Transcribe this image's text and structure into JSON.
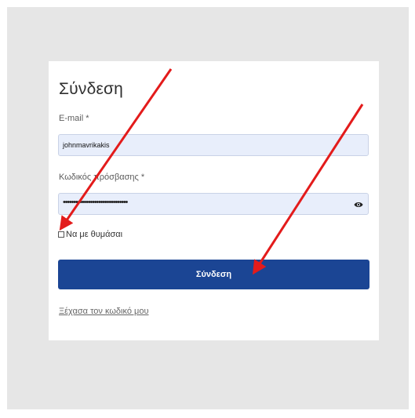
{
  "login": {
    "title": "Σύνδεση",
    "email_label": "E-mail *",
    "email_value": "johnmavrikakis",
    "password_label": "Κωδικός πρόσβασης *",
    "password_mask": "•••••••••••••••••••••••••••••••",
    "remember_label": "Να με θυμάσαι",
    "submit_label": "Σύνδεση",
    "forgot_link": "Ξέχασα τον κωδικό μου"
  },
  "annotations": {
    "arrow_color": "#e31b1b"
  },
  "icons": {
    "password_toggle": "eye-icon",
    "remember_checkbox": "checkbox-empty"
  },
  "colors": {
    "primary_button": "#1b4594",
    "input_background": "#e8eefb",
    "page_background": "#e6e6e6"
  }
}
